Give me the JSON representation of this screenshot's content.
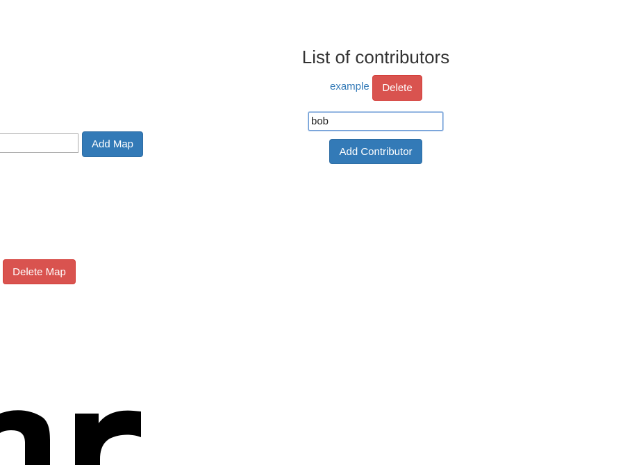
{
  "maps": {
    "new_map_value": "",
    "add_map_label": "Add Map",
    "delete_map_label": "Delete Map"
  },
  "contributors": {
    "title": "List of contributors",
    "items": [
      {
        "name": "example",
        "delete_label": "Delete"
      }
    ],
    "new_contributor_value": "bob",
    "add_contributor_label": "Add Contributor"
  },
  "colors": {
    "primary": "#337ab7",
    "danger": "#d9534f",
    "link": "#337ab7"
  },
  "icons": {
    "logo": "partial-logo-graphic"
  }
}
